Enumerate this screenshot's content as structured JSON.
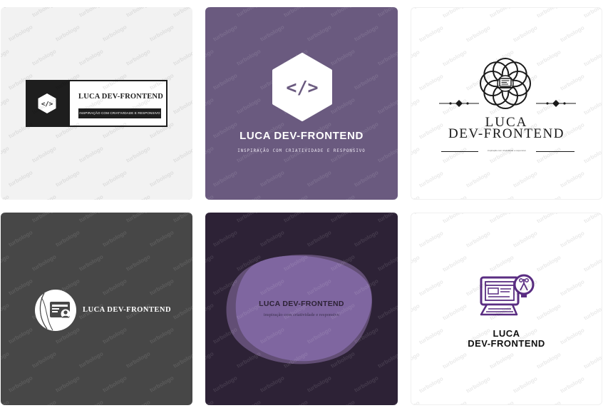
{
  "watermark": "turbologo",
  "cards": [
    {
      "title": "LUCA DEV-FRONTEND",
      "subtitle": "INSPIRAÇÃO COM CRIATIVIDADE E RESPONSIVO",
      "icon": "code-hexagon-icon",
      "icon_text": "</>"
    },
    {
      "title": "LUCA DEV-FRONTEND",
      "subtitle": "INSPIRAÇÃO COM CRIATIVIDADE E RESPONSIVO",
      "icon": "code-hexagon-icon",
      "icon_text": "</>"
    },
    {
      "title_line1": "LUCA",
      "title_line2": "DEV-FRONTEND",
      "subtitle": "inspiração com criatividade e responsivo",
      "icon": "flower-laptop-icon"
    },
    {
      "title": "LUCA DEV-FRONTEND",
      "icon": "web-developer-circle-icon"
    },
    {
      "title": "LUCA DEV-FRONTEND",
      "subtitle": "inspiração com criatividade e responsivo",
      "icon": "purple-blob-shape"
    },
    {
      "title_line1": "LUCA",
      "title_line2": "DEV-FRONTEND",
      "icon": "computer-lightbulb-icon"
    }
  ],
  "colors": {
    "card1_bg": "#f2f2f2",
    "card2_bg": "#6a5a7f",
    "card3_bg": "#ffffff",
    "card4_bg": "#474747",
    "card5_bg": "#2d2236",
    "card6_bg": "#ffffff",
    "accent_purple": "#5a2d82"
  }
}
